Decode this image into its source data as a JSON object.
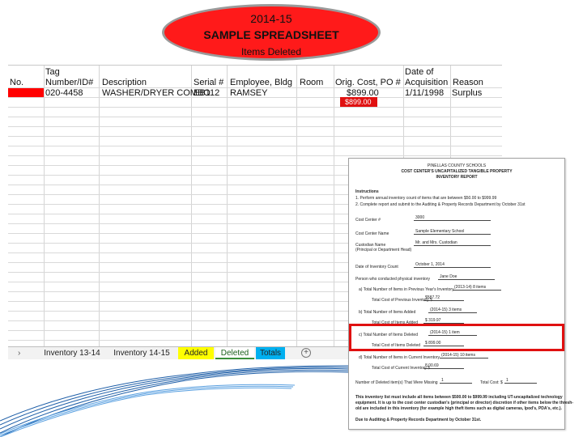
{
  "title": {
    "line1": "2014-15",
    "line2": "SAMPLE SPREADSHEET",
    "line3": "Items Deleted"
  },
  "sheet": {
    "headers": {
      "no": "No.",
      "tag_top": "Tag",
      "tag_bottom": "Number/ID#",
      "description": "Description",
      "serial": "Serial #",
      "employee": "Employee, Bldg",
      "room": "Room",
      "cost": "Orig. Cost, PO #",
      "date_top": "Date of",
      "date_bottom": "Acquisition",
      "reason": "Reason"
    },
    "rows": [
      {
        "tag": "020-4458",
        "description": "WASHER/DRYER COMBO",
        "serial": "EB112",
        "employee": "RAMSEY",
        "cost": "$899.00",
        "cost_sub": "$899.00",
        "date": "1/11/1998",
        "reason": "Surplus"
      }
    ]
  },
  "tabs": [
    "Inventory 13-14",
    "Inventory 14-15",
    "Added",
    "Deleted",
    "Totals"
  ],
  "tab_colors": {
    "Inventory 13-14": "#f2f2f2",
    "Inventory 14-15": "#f2f2f2",
    "Added": "#ffff00",
    "Deleted": "#ffffff",
    "Totals": "#00b0f0"
  },
  "report": {
    "header1": "PINELLAS COUNTY SCHOOLS",
    "header2": "COST CENTER'S UNCAPITALIZED TANGIBLE PROPERTY",
    "header3": "INVENTORY REPORT",
    "instructions_label": "Instructions",
    "instruction1": "1. Perform annual inventory count of items that are between $50.00 to $999.99",
    "instruction2": "2. Complete report and submit to the Auditing & Property Records Department by October 31st",
    "cost_center_label": "Cost Center #",
    "cost_center_value": "3000",
    "cost_center_name_label": "Cost Center Name",
    "cost_center_name_value": "Sample Elementary School",
    "custodian_label": "Custodian Name",
    "custodian_sub": "(Principal or Department Head)",
    "custodian_value": "Mr. and Mrs. Custodian",
    "date_label": "Date of Inventory Count",
    "date_value": "October 1, 2014",
    "person_label": "Person who conducted physical inventory",
    "person_value": "Jane Doe",
    "a_label": "a) Total Number of Items in Previous Year's Inventory",
    "a_value": "(2013-14) 8 items",
    "a_cost_label": "Total Cost of Previous Inventory $",
    "a_cost_value": "$587.72",
    "b_label": "b) Total Number of Items Added",
    "b_value": "(2014-15) 3 items",
    "b_cost_label": "Total Cost of Items Added",
    "b_cost_value": "$ 319.97",
    "c_label": "c) Total Number of Items Deleted",
    "c_value": "(2014-15) 1 item",
    "c_cost_label": "Total Cost of Items Deleted",
    "c_cost_value": "$ 899.00",
    "d_label": "d) Total Number of Items in Current Inventory",
    "d_value": "(2014-15) 10 items",
    "d_cost_label": "Total Cost of Current Inventory $",
    "d_cost_value": "8,00.69",
    "missing_label": "Number of Deleted item(s) That Were Missing",
    "missing_value": "1",
    "total_cost_label": "Total Cost: $",
    "total_cost_value": "1",
    "note1": "This inventory list must include all items between $500.00 to $999.99 including UT-uncapitalized technology",
    "note2": "equipment. It is up to the cost center custodian's (principal or director) discretion if other items below the thresh-",
    "note3": "old are included in this inventory (for example high theft items such as digital cameras, Ipod's, PDA's, etc.).",
    "note4": "Due to Auditing & Property Records Department by October 31st."
  },
  "colors": {
    "accent_red": "#ff0000",
    "highlight_red": "#e01010",
    "oval_border": "#9a9a9a",
    "swirl_blue": "#1f5fa8"
  },
  "icons": {
    "nav": "chevron-right-icon",
    "add_sheet": "plus-circle-icon"
  }
}
